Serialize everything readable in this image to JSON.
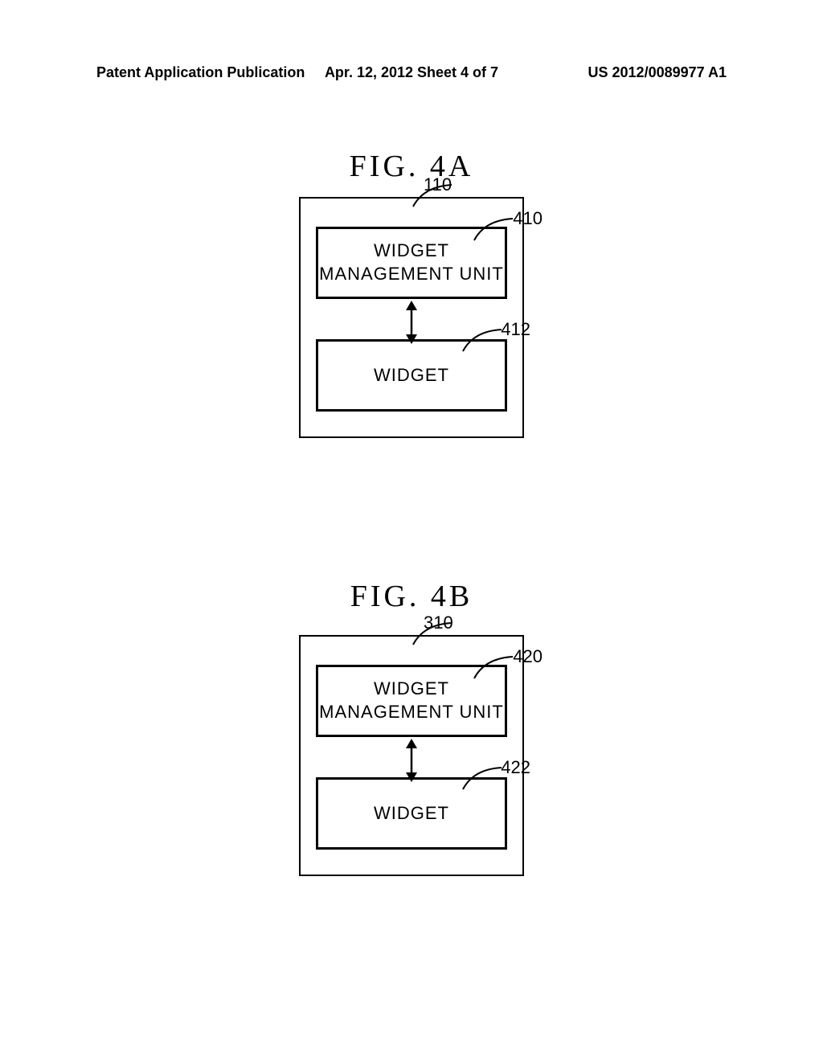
{
  "header": {
    "left": "Patent Application Publication",
    "center": "Apr. 12, 2012  Sheet 4 of 7",
    "right": "US 2012/0089977 A1"
  },
  "figA": {
    "title": "FIG.  4A",
    "outerRef": "110",
    "box1": {
      "ref": "410",
      "line1": "WIDGET",
      "line2": "MANAGEMENT UNIT"
    },
    "box2": {
      "ref": "412",
      "text": "WIDGET"
    }
  },
  "figB": {
    "title": "FIG.  4B",
    "outerRef": "310",
    "box1": {
      "ref": "420",
      "line1": "WIDGET",
      "line2": "MANAGEMENT UNIT"
    },
    "box2": {
      "ref": "422",
      "text": "WIDGET"
    }
  }
}
